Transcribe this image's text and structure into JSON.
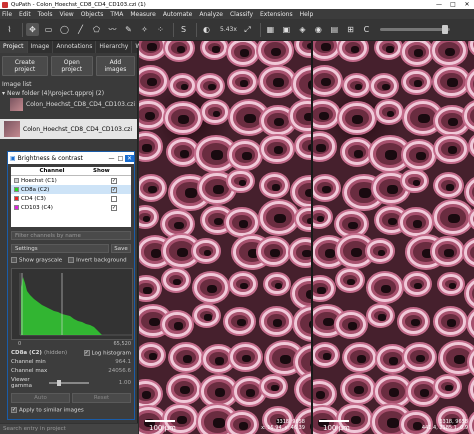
{
  "window": {
    "title": "QuPath - Colon_Hoechst_CD8_CD4_CD103.czi (1)",
    "controls": [
      "—",
      "□",
      "✕"
    ]
  },
  "menu": [
    "File",
    "Edit",
    "Tools",
    "View",
    "Objects",
    "TMA",
    "Measure",
    "Automate",
    "Analyze",
    "Classify",
    "Extensions",
    "Help"
  ],
  "toolbar": {
    "zoom": "5.43x"
  },
  "left": {
    "tabs": [
      "Project",
      "Image",
      "Annotations",
      "Hierarchy",
      "Work"
    ],
    "buttons": [
      "Create project",
      "Open project",
      "Add images"
    ],
    "image_list_label": "Image list",
    "folder": "New folder (4)\\project.qpproj (2)",
    "folder_image": "Colon_Hoechst_CD8_CD4_CD103.czi",
    "selected_image": "Colon_Hoechst_CD8_CD4_CD103.czi",
    "search_placeholder": "Search entry in project"
  },
  "bc": {
    "title": "Brightness & contrast",
    "col_channel": "Channel",
    "col_show": "Show",
    "channels": [
      {
        "name": "Hoechst (C1)",
        "color": "#d0d0d0",
        "checked": "✓"
      },
      {
        "name": "CD8a (C2)",
        "color": "#22dd22",
        "checked": "✓"
      },
      {
        "name": "CD4 (C3)",
        "color": "#ee2222",
        "checked": ""
      },
      {
        "name": "CD103 (C4)",
        "color": "#dd22dd",
        "checked": "✓"
      }
    ],
    "filter_placeholder": "Filter channels by name",
    "settings": "Settings",
    "save": "Save",
    "show_grayscale": "Show grayscale",
    "invert_background": "Invert background",
    "hist_min": "0",
    "hist_max": "65,520",
    "channel_label": "CD8a (C2)",
    "channel_hidden": "(hidden)",
    "log_histogram": "Log histogram",
    "channel_min_label": "Channel min",
    "channel_min": "964.1",
    "channel_max_label": "Channel max",
    "channel_max": "24056.6",
    "gamma_label": "Viewer gamma",
    "gamma": "1.00",
    "auto": "Auto",
    "reset": "Reset",
    "apply_similar": "Apply to similar images"
  },
  "viewer": {
    "scale": "100 µm",
    "cursor_left": "3318, 9658\nx: 15.94, y: 46.39",
    "cursor_right": "3318, 9658\n441.4, 2185.1, 0.9"
  }
}
